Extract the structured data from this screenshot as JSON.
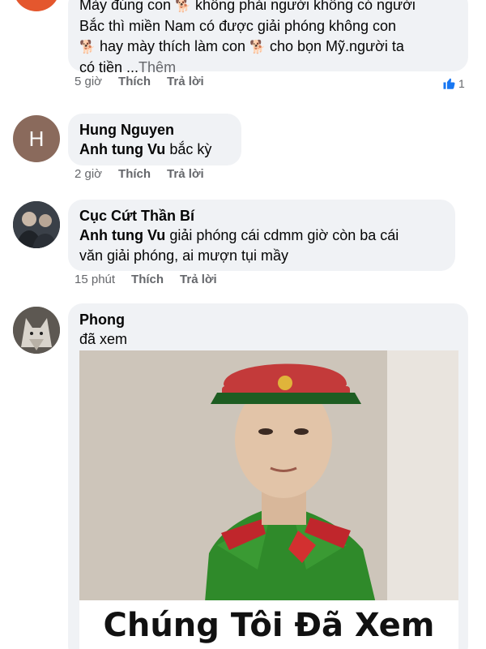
{
  "comments": [
    {
      "id": "c1",
      "partial_line1": "Mày đúng con",
      "partial_line1b": "không phải người không có người",
      "line2": "Bắc thì miền Nam có được giải phóng không con",
      "line3a": "hay mày thích làm con",
      "line3b": "cho bọn Mỹ.người ta",
      "line4": "có tiền ...",
      "more_label": "Thêm",
      "time": "5 giờ",
      "like_label": "Thích",
      "reply_label": "Trả lời",
      "reaction_count": "1"
    },
    {
      "id": "c2",
      "author": "Hung Nguyen",
      "avatar_initial": "H",
      "mention": "Anh tung Vu",
      "text": "bắc kỳ",
      "time": "2 giờ",
      "like_label": "Thích",
      "reply_label": "Trả lời"
    },
    {
      "id": "c3",
      "author": "Cục Cứt Thần Bí",
      "mention": "Anh tung Vu",
      "text_line1": "giải phóng cái cdmm giờ còn ba cái",
      "text_line2": "văn giải phóng, ai mượn tụi mầy",
      "time": "15 phút",
      "like_label": "Thích",
      "reply_label": "Trả lời"
    },
    {
      "id": "c4",
      "author": "Phong",
      "text": "đã xem",
      "image_caption": "Chúng Tôi Đã Xem"
    }
  ],
  "colors": {
    "bubble": "#f0f2f5",
    "meta": "#65676b",
    "like_blue": "#1877f2",
    "avatar_h": "#8a6a5c",
    "uniform_green": "#2f8a2a",
    "cap_red": "#b3262a"
  }
}
